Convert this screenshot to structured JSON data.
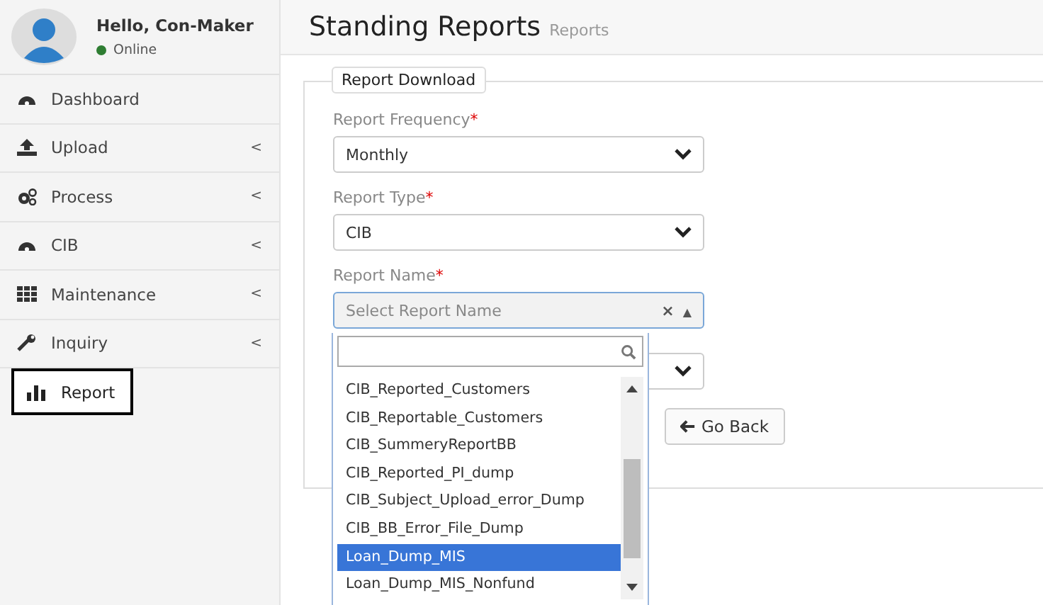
{
  "user": {
    "greeting": "Hello, Con-Maker",
    "status": "Online"
  },
  "sidebar": {
    "items": [
      {
        "label": "Dashboard",
        "selected": false
      },
      {
        "label": "Upload",
        "caret": "<",
        "selected": false
      },
      {
        "label": "Process",
        "caret": "<",
        "selected": false
      },
      {
        "label": "CIB",
        "caret": "<",
        "selected": false
      },
      {
        "label": "Maintenance",
        "caret": "<",
        "selected": false
      },
      {
        "label": "Inquiry",
        "caret": "<",
        "selected": false
      },
      {
        "label": "Report",
        "selected": true
      }
    ]
  },
  "page": {
    "title": "Standing Reports",
    "subtitle": "Reports"
  },
  "form": {
    "legend": "Report Download",
    "fields": [
      {
        "label": "Report Frequency",
        "required_mark": "*",
        "value": "Monthly"
      },
      {
        "label": "Report Type",
        "required_mark": "*",
        "value": "CIB"
      },
      {
        "label": "Report Name",
        "required_mark": "*",
        "placeholder": "Select Report Name",
        "clear": "×",
        "toggle": "▲",
        "expanded": true
      }
    ],
    "back_button": "Go Back"
  },
  "dropdown": {
    "options": [
      {
        "label": "CIB_Reported_Customers",
        "selected": false
      },
      {
        "label": "CIB_Reportable_Customers",
        "selected": false
      },
      {
        "label": "CIB_SummeryReportBB",
        "selected": false
      },
      {
        "label": "CIB_Reported_PI_dump",
        "selected": false
      },
      {
        "label": "CIB_Subject_Upload_error_Dump",
        "selected": false
      },
      {
        "label": "CIB_BB_Error_File_Dump",
        "selected": false
      },
      {
        "label": "Loan_Dump_MIS",
        "selected": true
      },
      {
        "label": "Loan_Dump_MIS_Nonfund",
        "selected": false
      }
    ]
  }
}
